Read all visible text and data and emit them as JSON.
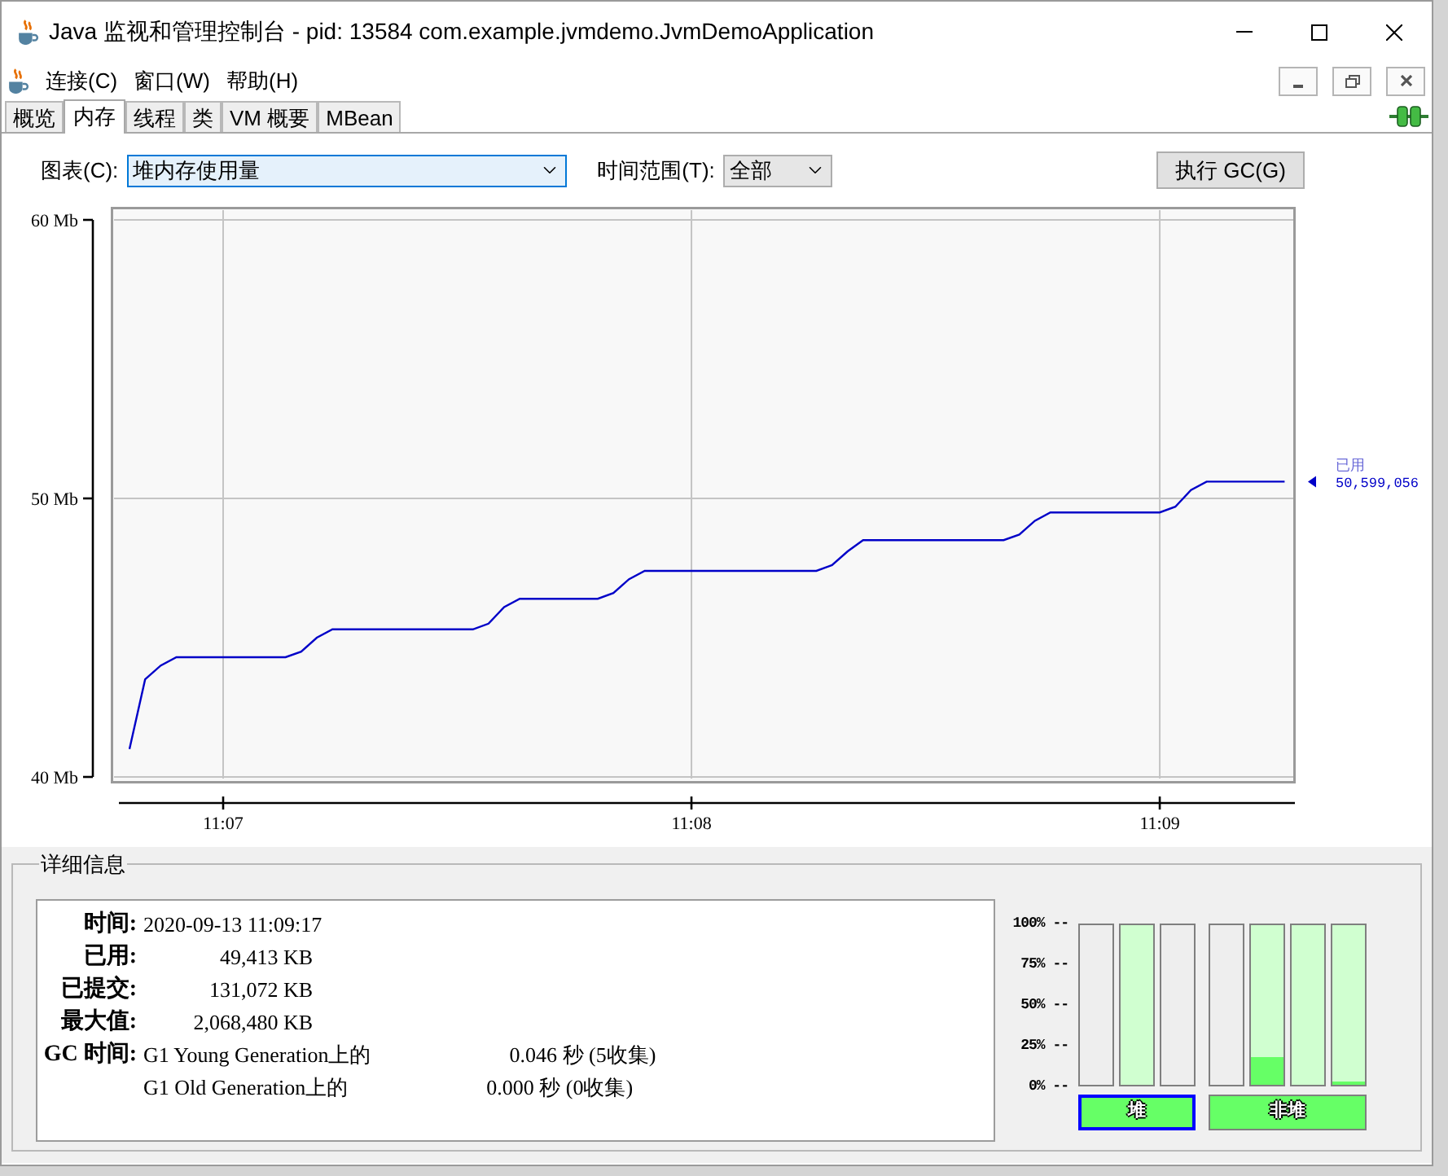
{
  "window": {
    "title": "Java 监视和管理控制台 - pid: 13584 com.example.jvmdemo.JvmDemoApplication"
  },
  "menu": [
    "连接(C)",
    "窗口(W)",
    "帮助(H)"
  ],
  "tabs": [
    {
      "label": "概览",
      "selected": false
    },
    {
      "label": "内存",
      "selected": true
    },
    {
      "label": "线程",
      "selected": false
    },
    {
      "label": "类",
      "selected": false
    },
    {
      "label": "VM 概要",
      "selected": false
    },
    {
      "label": "MBean",
      "selected": false
    }
  ],
  "toolbar": {
    "chart_label": "图表(C):",
    "chart_select": "堆内存使用量",
    "range_label": "时间范围(T):",
    "range_select": "全部",
    "gc_button": "执行 GC(G)"
  },
  "memory_chart": {
    "chart_data": {
      "type": "line",
      "grid": true,
      "categories": [
        null,
        null,
        null,
        null,
        null,
        null,
        "11:07",
        null,
        null,
        null,
        null,
        null,
        null,
        null,
        null,
        null,
        null,
        null,
        null,
        null,
        null,
        null,
        null,
        null,
        null,
        null,
        null,
        null,
        null,
        null,
        null,
        null,
        null,
        null,
        null,
        null,
        "11:08",
        null,
        null,
        null,
        null,
        null,
        null,
        null,
        null,
        null,
        null,
        null,
        null,
        null,
        null,
        null,
        null,
        null,
        null,
        null,
        null,
        null,
        null,
        null,
        null,
        null,
        null,
        null,
        null,
        null,
        "11:09",
        null,
        null,
        null,
        null,
        null,
        null,
        null,
        null
      ],
      "series": [
        {
          "name": "已用",
          "color": "#0000c8",
          "values": [
            41.0,
            43.5,
            44.0,
            44.3,
            44.3,
            44.3,
            44.3,
            44.3,
            44.3,
            44.3,
            44.3,
            44.5,
            45.0,
            45.3,
            45.3,
            45.3,
            45.3,
            45.3,
            45.3,
            45.3,
            45.3,
            45.3,
            45.3,
            45.5,
            46.1,
            46.4,
            46.4,
            46.4,
            46.4,
            46.4,
            46.4,
            46.6,
            47.1,
            47.4,
            47.4,
            47.4,
            47.4,
            47.4,
            47.4,
            47.4,
            47.4,
            47.4,
            47.4,
            47.4,
            47.4,
            47.6,
            48.1,
            48.5,
            48.5,
            48.5,
            48.5,
            48.5,
            48.5,
            48.5,
            48.5,
            48.5,
            48.5,
            48.7,
            49.2,
            49.5,
            49.5,
            49.5,
            49.5,
            49.5,
            49.5,
            49.5,
            49.5,
            49.7,
            50.3,
            50.6,
            50.6,
            50.6,
            50.6,
            50.6,
            50.6
          ]
        }
      ],
      "ylim": [
        40,
        60
      ],
      "yticks": [
        {
          "value": 60,
          "label": "60 Mb"
        },
        {
          "value": 50,
          "label": "50 Mb"
        },
        {
          "value": 40,
          "label": "40 Mb"
        }
      ]
    },
    "current_value": "50,599,056"
  },
  "details": {
    "title": "详细信息",
    "rows": [
      {
        "kind": "text",
        "label": "时间:",
        "value": "2020-09-13 11:09:17"
      },
      {
        "kind": "number",
        "label": "已用:",
        "value": "49,413 KB"
      },
      {
        "kind": "number",
        "label": "已提交:",
        "value": "131,072 KB"
      },
      {
        "kind": "number",
        "label": "最大值:",
        "value": "2,068,480 KB"
      }
    ],
    "gc": {
      "label": "GC 时间:",
      "collectors": [
        {
          "name": "G1 Young Generation上的",
          "time": "0.046 秒 (5收集)"
        },
        {
          "name": "G1 Old Generation上的",
          "time": "0.000 秒 (0收集)"
        }
      ]
    }
  },
  "pool_chart": {
    "scale": [
      "100% --",
      "75% --",
      "50% --",
      "25% --",
      "0% --"
    ],
    "groups": [
      {
        "label": "堆",
        "selected": true,
        "bars": [
          {
            "committed": false
          },
          {
            "committed": true
          },
          {
            "committed": false
          }
        ]
      },
      {
        "label": "非堆",
        "selected": false,
        "bars": [
          {
            "committed": false
          },
          {
            "committed": true,
            "level": 0.17
          },
          {
            "committed": true
          },
          {
            "committed": true,
            "level": 0.02
          }
        ]
      }
    ]
  }
}
